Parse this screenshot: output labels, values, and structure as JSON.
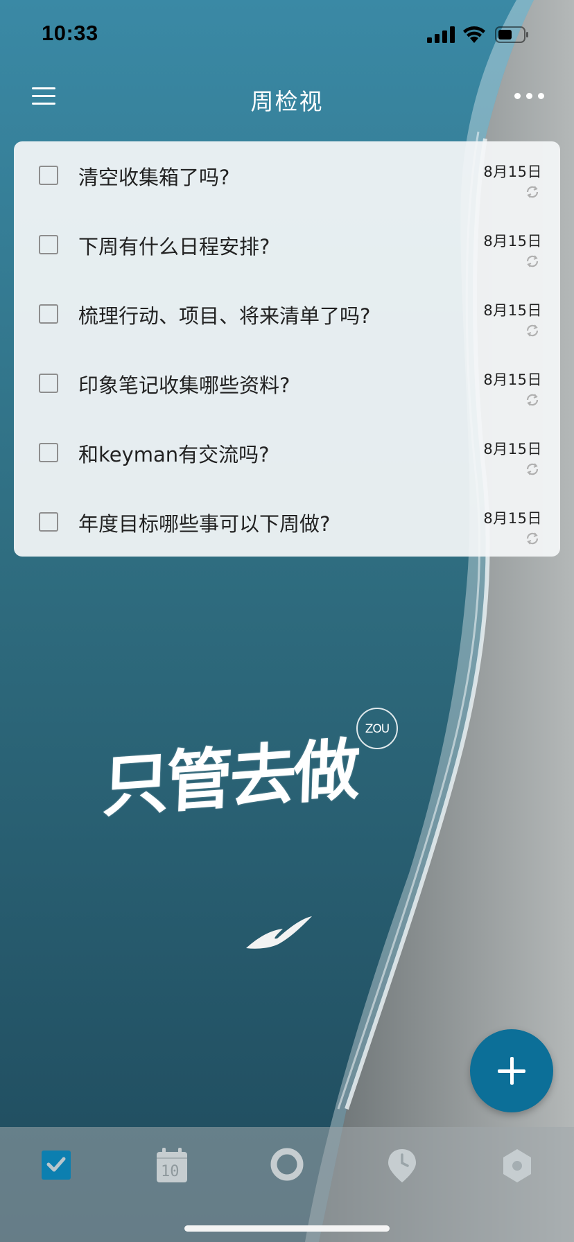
{
  "status_bar": {
    "time": "10:33",
    "icons": [
      "cellular-signal-icon",
      "wifi-icon",
      "battery-icon"
    ]
  },
  "nav": {
    "title": "周检视",
    "left_icon": "hamburger-menu-icon",
    "right_icon": "more-options-icon"
  },
  "tasks": [
    {
      "title": "清空收集箱了吗?",
      "date": "8月15日",
      "repeat": true,
      "checked": false
    },
    {
      "title": "下周有什么日程安排?",
      "date": "8月15日",
      "repeat": true,
      "checked": false
    },
    {
      "title": "梳理行动、项目、将来清单了吗?",
      "date": "8月15日",
      "repeat": true,
      "checked": false
    },
    {
      "title": "印象笔记收集哪些资料?",
      "date": "8月15日",
      "repeat": true,
      "checked": false
    },
    {
      "title": "和keyman有交流吗?",
      "date": "8月15日",
      "repeat": true,
      "checked": false
    },
    {
      "title": "年度目标哪些事可以下周做?",
      "date": "8月15日",
      "repeat": true,
      "checked": false
    }
  ],
  "watermark": {
    "text": "只管去做",
    "badge": "ZOU"
  },
  "fab": {
    "icon": "plus-icon"
  },
  "tab_bar": {
    "items": [
      {
        "icon": "checkbox-icon",
        "active": true
      },
      {
        "icon": "calendar-icon",
        "label": "10",
        "active": false
      },
      {
        "icon": "focus-circle-icon",
        "active": false
      },
      {
        "icon": "location-clock-icon",
        "active": false
      },
      {
        "icon": "hexagon-icon",
        "active": false
      }
    ]
  },
  "colors": {
    "accent": "#0c6f98",
    "card_bg": "#f4f6f8",
    "text": "#222222"
  }
}
